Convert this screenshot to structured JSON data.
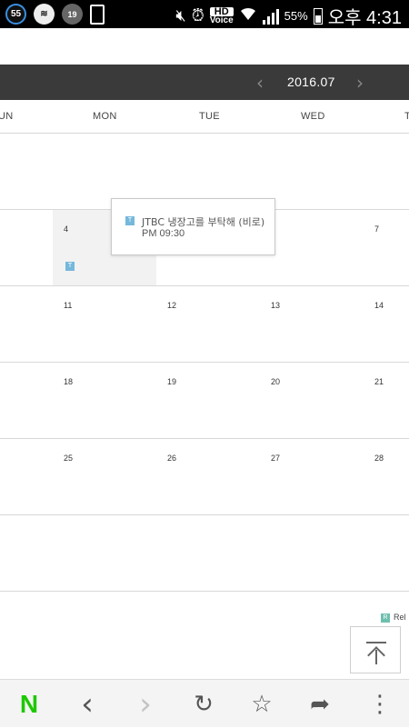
{
  "status_bar": {
    "badge_count": "55",
    "mini_badge": "19",
    "hd_label": "HD",
    "voice_label": "Voice",
    "battery_percent": "55%",
    "time": "오후 4:31",
    "icons": [
      "notification-count-icon",
      "layers-icon",
      "age-rating-icon",
      "document-icon",
      "mute-icon",
      "alarm-icon",
      "hd-voice-icon",
      "wifi-icon",
      "signal-icon",
      "battery-icon"
    ]
  },
  "calendar": {
    "month_label": "2016.07",
    "prev_icon": "‹",
    "next_icon": "›",
    "weekdays": [
      "UN",
      "MON",
      "TUE",
      "WED",
      "T"
    ],
    "weeks": [
      {
        "days": []
      },
      {
        "days": [
          "4",
          "7"
        ]
      },
      {
        "days": [
          "11",
          "12",
          "13",
          "14"
        ]
      },
      {
        "days": [
          "18",
          "19",
          "20",
          "21"
        ]
      },
      {
        "days": [
          "25",
          "26",
          "27",
          "28"
        ]
      },
      {
        "days": []
      }
    ],
    "event_tag": "T",
    "related_tag": "R",
    "related_label": "Rel"
  },
  "popup": {
    "tag": "T",
    "title": "JTBC 냉장고를 부탁해 (비로)",
    "time": "PM 09:30"
  },
  "browser_bar": {
    "logo": "N",
    "back": "‹",
    "forward": "›",
    "reload": "↻",
    "bookmark": "☆",
    "share": "➦",
    "menu": "⋮"
  },
  "colors": {
    "header_bg": "#3a3a3a",
    "event_tag": "#76b8db",
    "naver_green": "#1ec800"
  }
}
